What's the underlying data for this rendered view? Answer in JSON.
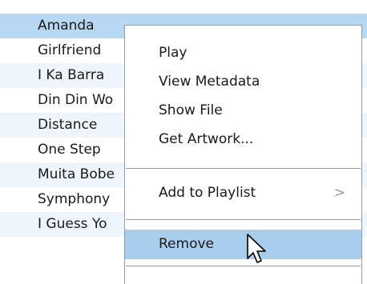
{
  "track_list": {
    "rows": [
      {
        "title": "Amanda"
      },
      {
        "title": "Girlfriend"
      },
      {
        "title": "I Ka Barra"
      },
      {
        "title": "Din Din Wo"
      },
      {
        "title": "Distance"
      },
      {
        "title": "One Step"
      },
      {
        "title": "Muita Bobe"
      },
      {
        "title": "Symphony"
      },
      {
        "title": "I Guess Yo"
      }
    ]
  },
  "context_menu": {
    "play": "Play",
    "view_metadata": "View Metadata",
    "show_file": "Show File",
    "get_artwork": "Get Artwork...",
    "add_to_playlist": "Add to Playlist",
    "submenu_arrow": ">",
    "remove": "Remove"
  },
  "colors": {
    "selected_row": "#b7d7f3",
    "alternate_row": "#eef5fc",
    "menu_highlight": "#a9cdec",
    "menu_border": "#9a9a9a"
  },
  "icons": {
    "cursor": "arrow-cursor-icon"
  }
}
